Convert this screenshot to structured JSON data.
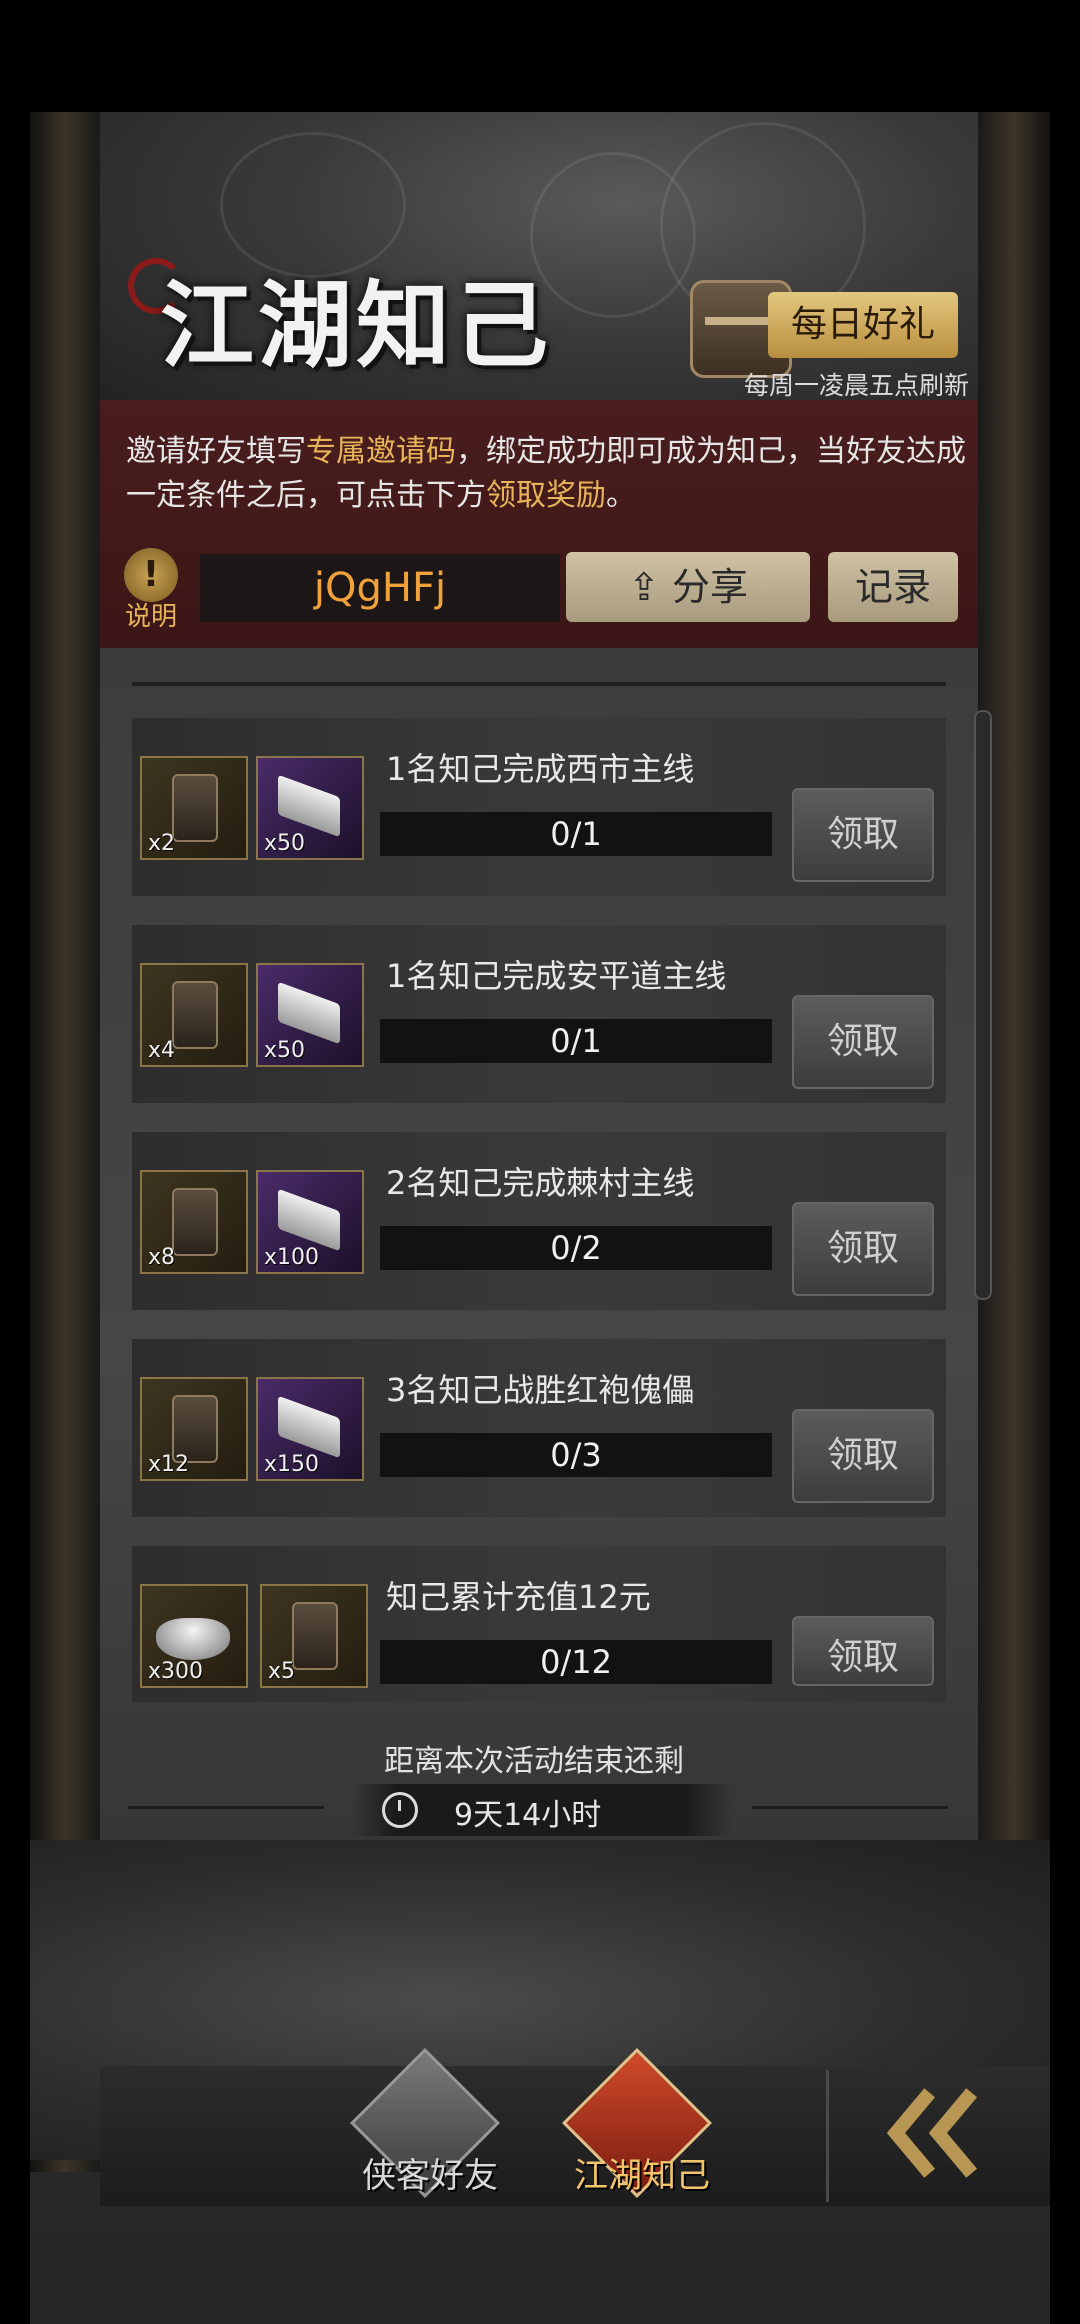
{
  "header": {
    "title": "江湖知己",
    "daily_gift_label": "每日好礼",
    "refresh_note": "每周一凌晨五点刷新"
  },
  "invite": {
    "text_part1": "邀请好友填写",
    "text_highlight1": "专属邀请码",
    "text_part2": "，绑定成功即可成为知己，当好友达成一定条件之后，可点击下方",
    "text_highlight2": "领取奖励",
    "text_part3": "。",
    "help_icon": "!",
    "help_label": "说明",
    "code": "jQgHFj",
    "share_label": "分享",
    "record_label": "记录"
  },
  "tasks": [
    {
      "title": "1名知己完成西市主线",
      "progress": "0/1",
      "claim": "领取",
      "rewards": [
        {
          "icon": "token-icon",
          "bg": "gold",
          "qty": "x2"
        },
        {
          "icon": "silver-ingot-icon",
          "bg": "purple",
          "qty": "x50"
        }
      ]
    },
    {
      "title": "1名知己完成安平道主线",
      "progress": "0/1",
      "claim": "领取",
      "rewards": [
        {
          "icon": "token-icon",
          "bg": "gold",
          "qty": "x4"
        },
        {
          "icon": "silver-ingot-icon",
          "bg": "purple",
          "qty": "x50"
        }
      ]
    },
    {
      "title": "2名知己完成棘村主线",
      "progress": "0/2",
      "claim": "领取",
      "rewards": [
        {
          "icon": "token-icon",
          "bg": "gold",
          "qty": "x8"
        },
        {
          "icon": "silver-ingot-icon",
          "bg": "purple",
          "qty": "x100"
        }
      ]
    },
    {
      "title": "3名知己战胜红袍傀儡",
      "progress": "0/3",
      "claim": "领取",
      "rewards": [
        {
          "icon": "token-icon",
          "bg": "gold",
          "qty": "x12"
        },
        {
          "icon": "silver-ingot-icon",
          "bg": "purple",
          "qty": "x150"
        }
      ]
    },
    {
      "title": "知己累计充值12元",
      "progress": "0/12",
      "claim": "领取",
      "rewards": [
        {
          "icon": "silver-yuanbao-icon",
          "bg": "gold",
          "qty": "x300"
        },
        {
          "icon": "token-icon",
          "bg": "gold",
          "qty": "x5"
        }
      ]
    }
  ],
  "countdown": {
    "label": "距离本次活动结束还剩",
    "time": "9天14小时"
  },
  "bottom_nav": {
    "friends_label": "侠客好友",
    "zhiji_label": "江湖知己"
  },
  "colors": {
    "highlight": "#e8b45a",
    "code": "#f0a23a",
    "panel_red": "#4a1d1d"
  }
}
